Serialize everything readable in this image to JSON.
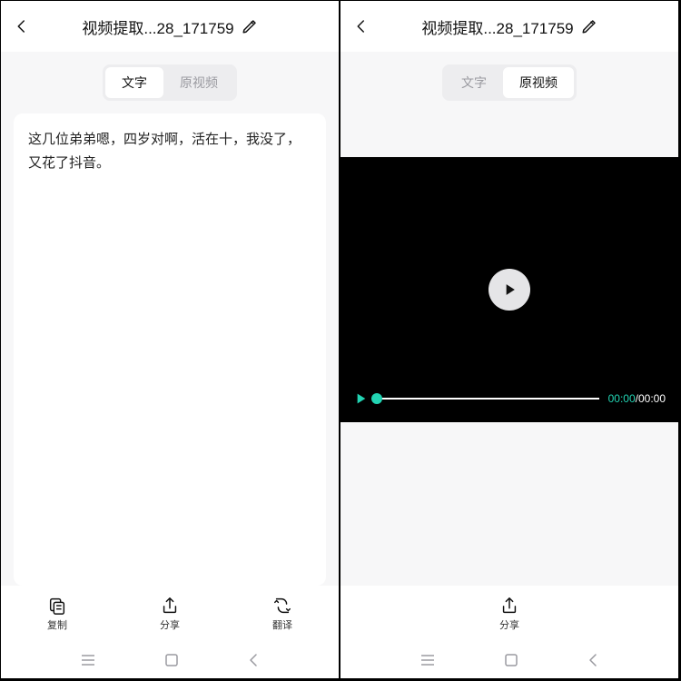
{
  "left": {
    "title": "视频提取...28_171759",
    "tabs": {
      "text": "文字",
      "video": "原视频"
    },
    "activeTab": "text",
    "transcript": "这几位弟弟嗯，四岁对啊，活在十，我没了，又花了抖音。",
    "actions": {
      "copy": "复制",
      "share": "分享",
      "translate": "翻译"
    }
  },
  "right": {
    "title": "视频提取...28_171759",
    "tabs": {
      "text": "文字",
      "video": "原视频"
    },
    "activeTab": "video",
    "time": {
      "current": "00:00",
      "total": "00:00"
    },
    "actions": {
      "share": "分享"
    }
  }
}
